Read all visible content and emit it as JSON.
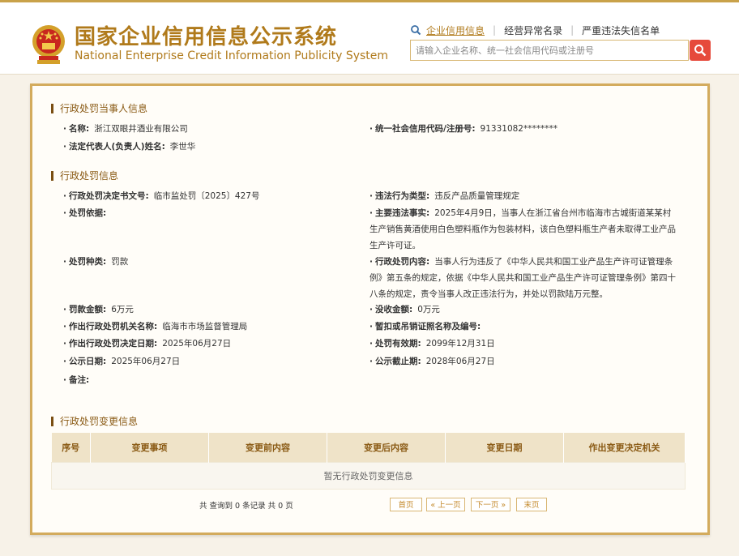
{
  "header": {
    "title_cn": "国家企业信用信息公示系统",
    "title_en": "National Enterprise Credit Information Publicity System",
    "nav": [
      {
        "label": "企业信用信息"
      },
      {
        "label": "经营异常名录"
      },
      {
        "label": "严重违法失信名单"
      }
    ],
    "search_placeholder": "请输入企业名称、统一社会信用代码或注册号"
  },
  "party": {
    "section_title": "行政处罚当事人信息",
    "name_label": "名称:",
    "name_value": "浙江双眼井酒业有限公司",
    "credit_code_label": "统一社会信用代码/注册号:",
    "credit_code_value": "91331082********",
    "legal_rep_label": "法定代表人(负责人)姓名:",
    "legal_rep_value": "李世华"
  },
  "penalty": {
    "section_title": "行政处罚信息",
    "decision_no_label": "行政处罚决定书文号:",
    "decision_no_value": "临市监处罚〔2025〕427号",
    "violation_type_label": "违法行为类型:",
    "violation_type_value": "违反产品质量管理规定",
    "basis_label": "处罚依据:",
    "basis_value": "",
    "facts_label": "主要违法事实:",
    "facts_value": "2025年4月9日，当事人在浙江省台州市临海市古城街道某某村生产销售黄酒使用白色塑料瓶作为包装材料，该白色塑料瓶生产者未取得工业产品生产许可证。",
    "kind_label": "处罚种类:",
    "kind_value": "罚款",
    "content_label": "行政处罚内容:",
    "content_value": "当事人行为违反了《中华人民共和国工业产品生产许可证管理条例》第五条的规定，依据《中华人民共和国工业产品生产许可证管理条例》第四十八条的规定，责令当事人改正违法行为，并处以罚款陆万元整。",
    "amount_label": "罚款金额:",
    "amount_value": "6万元",
    "confiscation_label": "没收金额:",
    "confiscation_value": "0万元",
    "authority_label": "作出行政处罚机关名称:",
    "authority_value": "临海市市场监督管理局",
    "license_label": "暂扣或吊销证照名称及编号:",
    "license_value": "",
    "decision_date_label": "作出行政处罚决定日期:",
    "decision_date_value": "2025年06月27日",
    "valid_until_label": "处罚有效期:",
    "valid_until_value": "2099年12月31日",
    "publish_date_label": "公示日期:",
    "publish_date_value": "2025年06月27日",
    "publish_end_label": "公示截止期:",
    "publish_end_value": "2028年06月27日",
    "remark_label": "备注:",
    "remark_value": ""
  },
  "changes": {
    "section_title": "行政处罚变更信息",
    "columns": [
      "序号",
      "变更事项",
      "变更前内容",
      "变更后内容",
      "变更日期",
      "作出变更决定机关"
    ],
    "empty_text": "暂无行政处罚变更信息"
  },
  "pager": {
    "summary": "共 查询到 0 条记录 共 0 页",
    "first": "首页",
    "prev": "« 上一页",
    "next": "下一页 »",
    "last": "末页"
  },
  "colors": {
    "accent_gold": "#b07a1b",
    "panel_border": "#d3ab5d",
    "search_button": "#e64a3b"
  }
}
